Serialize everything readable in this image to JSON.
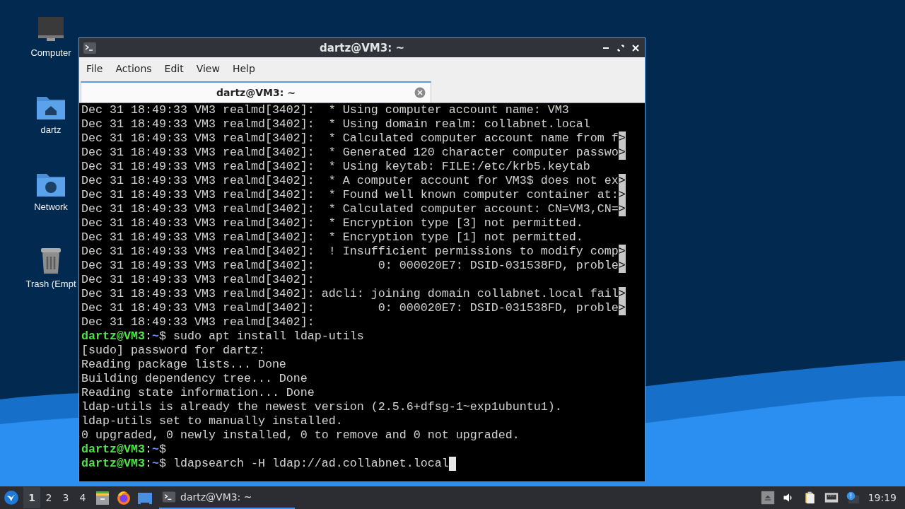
{
  "desktop": {
    "icons": [
      {
        "kind": "computer",
        "label": "Computer"
      },
      {
        "kind": "home",
        "label": "dartz"
      },
      {
        "kind": "network",
        "label": "Network"
      },
      {
        "kind": "trash",
        "label": "Trash (Empt"
      }
    ]
  },
  "window": {
    "title": "dartz@VM3: ~",
    "menu": [
      "File",
      "Actions",
      "Edit",
      "View",
      "Help"
    ],
    "tabs": [
      {
        "label": "dartz@VM3: ~",
        "selected": true
      }
    ],
    "terminal": {
      "lines": [
        {
          "kind": "log",
          "text": "Dec 31 18:49:33 VM3 realmd[3402]:  * Using computer account name: VM3"
        },
        {
          "kind": "log",
          "text": "Dec 31 18:49:33 VM3 realmd[3402]:  * Using domain realm: collabnet.local"
        },
        {
          "kind": "log",
          "text": "Dec 31 18:49:33 VM3 realmd[3402]:  * Calculated computer account name from f",
          "more": ">"
        },
        {
          "kind": "log",
          "text": "Dec 31 18:49:33 VM3 realmd[3402]:  * Generated 120 character computer passwo",
          "more": ">"
        },
        {
          "kind": "log",
          "text": "Dec 31 18:49:33 VM3 realmd[3402]:  * Using keytab: FILE:/etc/krb5.keytab"
        },
        {
          "kind": "log",
          "text": "Dec 31 18:49:33 VM3 realmd[3402]:  * A computer account for VM3$ does not ex",
          "more": ">"
        },
        {
          "kind": "log",
          "text": "Dec 31 18:49:33 VM3 realmd[3402]:  * Found well known computer container at:",
          "more": ">"
        },
        {
          "kind": "log",
          "text": "Dec 31 18:49:33 VM3 realmd[3402]:  * Calculated computer account: CN=VM3,CN=",
          "more": ">"
        },
        {
          "kind": "log",
          "text": "Dec 31 18:49:33 VM3 realmd[3402]:  * Encryption type [3] not permitted."
        },
        {
          "kind": "log",
          "text": "Dec 31 18:49:33 VM3 realmd[3402]:  * Encryption type [1] not permitted."
        },
        {
          "kind": "log",
          "text": "Dec 31 18:49:33 VM3 realmd[3402]:  ! Insufficient permissions to modify comp",
          "more": ">"
        },
        {
          "kind": "log",
          "text": "Dec 31 18:49:33 VM3 realmd[3402]:         0: 000020E7: DSID-031538FD, proble",
          "more": ">"
        },
        {
          "kind": "log",
          "text": "Dec 31 18:49:33 VM3 realmd[3402]:"
        },
        {
          "kind": "log",
          "text": "Dec 31 18:49:33 VM3 realmd[3402]: adcli: joining domain collabnet.local fail",
          "more": ">"
        },
        {
          "kind": "log",
          "text": "Dec 31 18:49:33 VM3 realmd[3402]:         0: 000020E7: DSID-031538FD, proble",
          "more": ">"
        },
        {
          "kind": "log",
          "text": "Dec 31 18:49:33 VM3 realmd[3402]:"
        },
        {
          "kind": "prompt",
          "user": "dartz@VM3",
          "sep": ":",
          "path": "~",
          "command": "$ sudo apt install ldap-utils"
        },
        {
          "kind": "log",
          "text": "[sudo] password for dartz:"
        },
        {
          "kind": "log",
          "text": "Reading package lists... Done"
        },
        {
          "kind": "log",
          "text": "Building dependency tree... Done"
        },
        {
          "kind": "log",
          "text": "Reading state information... Done"
        },
        {
          "kind": "log",
          "text": "ldap-utils is already the newest version (2.5.6+dfsg-1~exp1ubuntu1)."
        },
        {
          "kind": "log",
          "text": "ldap-utils set to manually installed."
        },
        {
          "kind": "log",
          "text": "0 upgraded, 0 newly installed, 0 to remove and 0 not upgraded."
        },
        {
          "kind": "prompt",
          "user": "dartz@VM3",
          "sep": ":",
          "path": "~",
          "command": "$"
        },
        {
          "kind": "prompt",
          "user": "dartz@VM3",
          "sep": ":",
          "path": "~",
          "command": "$ ldapsearch -H ldap://ad.collabnet.local",
          "cursor": true
        }
      ]
    }
  },
  "taskbar": {
    "workspaces": [
      {
        "label": "1",
        "selected": true
      },
      {
        "label": "2",
        "selected": false
      },
      {
        "label": "3",
        "selected": false
      },
      {
        "label": "4",
        "selected": false
      }
    ],
    "launchers": [
      {
        "kind": "files"
      },
      {
        "kind": "browser"
      },
      {
        "kind": "desktop"
      }
    ],
    "tasks": [
      {
        "label": "dartz@VM3: ~",
        "selected": true
      }
    ],
    "tray": [
      {
        "kind": "eject"
      },
      {
        "kind": "volume"
      },
      {
        "kind": "clipboard"
      },
      {
        "kind": "network"
      },
      {
        "kind": "notification"
      }
    ],
    "clock": "19:19"
  }
}
